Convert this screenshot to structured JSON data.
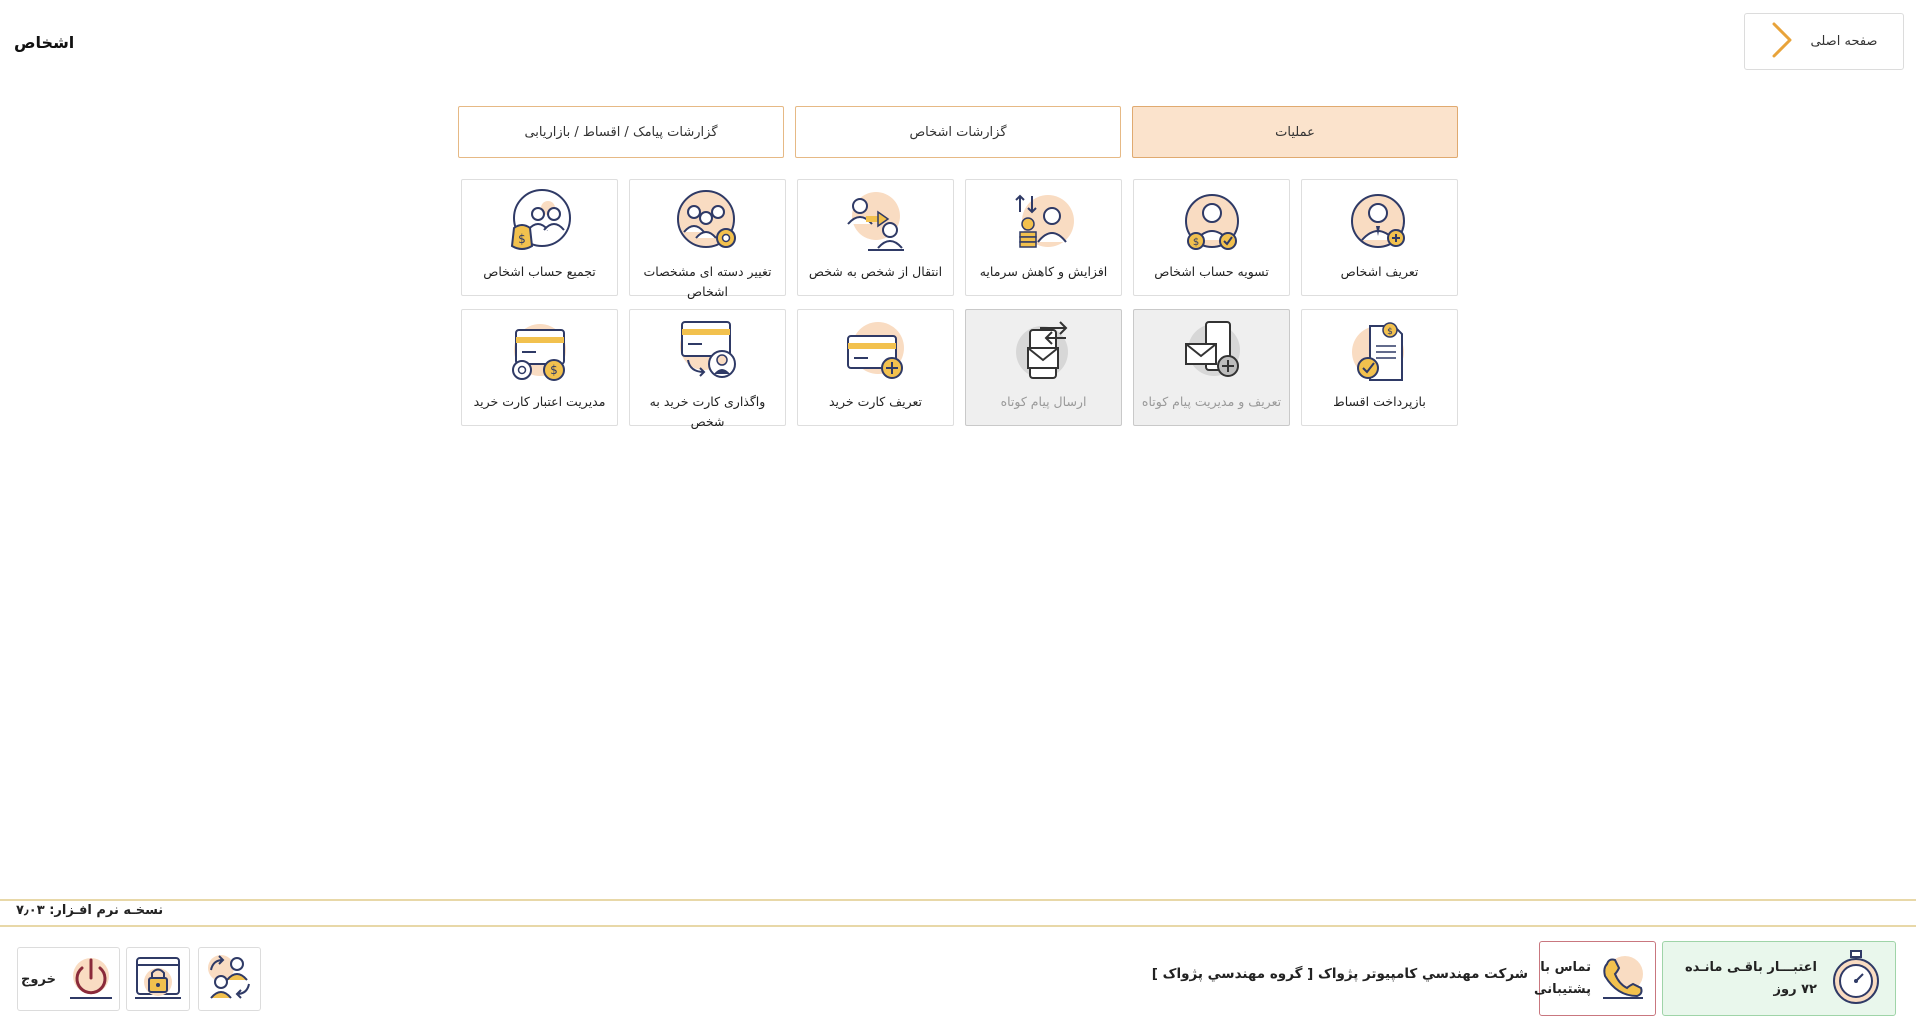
{
  "header": {
    "home_label": "صفحه اصلی",
    "page_title": "اشخاص"
  },
  "tabs": [
    {
      "label": "عملیات",
      "active": true
    },
    {
      "label": "گزارشات اشخاص",
      "active": false
    },
    {
      "label": "گزارشات پیامک / اقساط / بازاریابی",
      "active": false
    }
  ],
  "cards": [
    {
      "label": "تعریف اشخاص",
      "icon": "person-add-icon",
      "disabled": false
    },
    {
      "label": "تسویه حساب اشخاص",
      "icon": "person-settle-icon",
      "disabled": false
    },
    {
      "label": "افزایش و کاهش سرمایه",
      "icon": "capital-change-icon",
      "disabled": false
    },
    {
      "label": "انتقال از شخص به شخص",
      "icon": "person-transfer-icon",
      "disabled": false
    },
    {
      "label": "تغییر دسته ای مشخصات اشخاص",
      "icon": "group-settings-icon",
      "disabled": false
    },
    {
      "label": "تجمیع حساب اشخاص",
      "icon": "account-merge-icon",
      "disabled": false
    },
    {
      "label": "بازپرداخت اقساط",
      "icon": "installment-repay-icon",
      "disabled": false
    },
    {
      "label": "تعریف و مدیریت پیام کوتاه",
      "icon": "sms-manage-icon",
      "disabled": true
    },
    {
      "label": "ارسال پیام کوتاه",
      "icon": "sms-send-icon",
      "disabled": true
    },
    {
      "label": "تعریف کارت خرید",
      "icon": "card-add-icon",
      "disabled": false
    },
    {
      "label": "واگذاری کارت خرید به شخص",
      "icon": "card-assign-icon",
      "disabled": false
    },
    {
      "label": "مدیریت اعتبار کارت خرید",
      "icon": "card-credit-icon",
      "disabled": false
    }
  ],
  "footer": {
    "version": "نسخـه نرم افـزار: ۷٫۰۳",
    "credit_line1": "اعتبـــار باقـی مانـده",
    "credit_line2": "۷۲ روز",
    "support_line1": "تماس با",
    "support_line2": "پشتیبانی",
    "company": "شرکت مهندسي کامپيوتر پژواک [ گروه مهندسي پژواک ]",
    "exit_label": "خروج"
  },
  "colors": {
    "accent_orange": "#e8a33a",
    "tab_active_bg": "#fbe3cc",
    "credit_bg": "#e9f7ec",
    "support_border": "#c9777f",
    "icon_navy": "#2f3a66",
    "icon_peach": "#f9dcc2",
    "icon_gold": "#f2c14e"
  }
}
